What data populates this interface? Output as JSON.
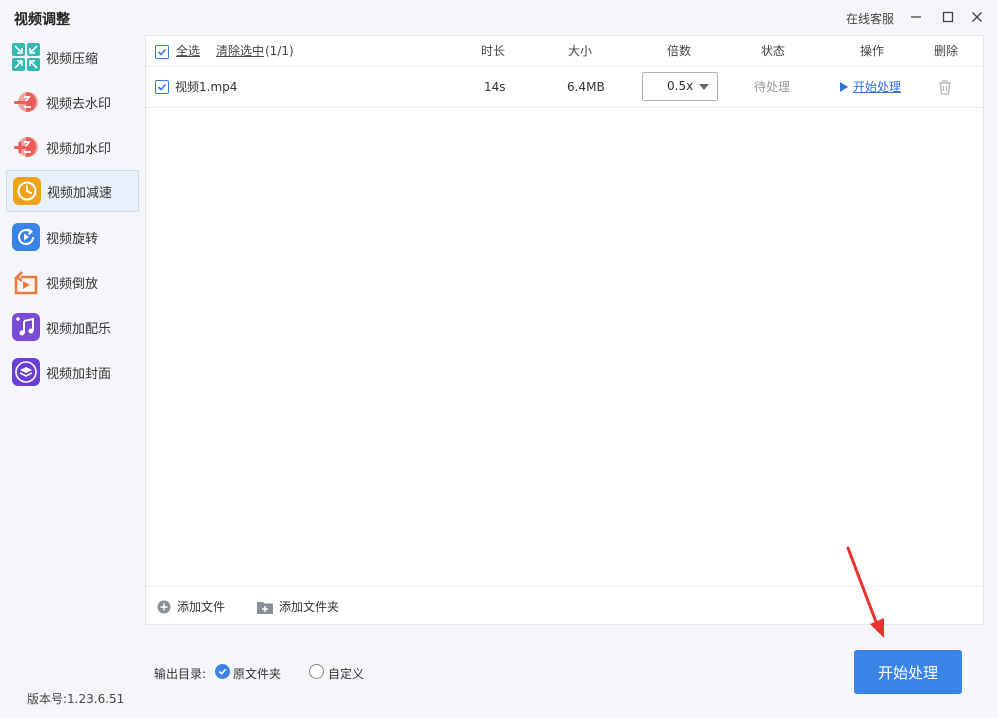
{
  "app": {
    "title": "视频调整",
    "service": "在线客服",
    "version": "版本号:1.23.6.51"
  },
  "sidebar": {
    "items": [
      {
        "label": "视频压缩",
        "icon": "compress-icon",
        "color": "#35b7b3"
      },
      {
        "label": "视频去水印",
        "icon": "remove-watermark-icon",
        "color": "#e85b57"
      },
      {
        "label": "视频加水印",
        "icon": "add-watermark-icon",
        "color": "#e85b57"
      },
      {
        "label": "视频加减速",
        "icon": "speed-icon",
        "color": "#f0a21b",
        "active": true
      },
      {
        "label": "视频旋转",
        "icon": "rotate-icon",
        "color": "#3a84e8"
      },
      {
        "label": "视频倒放",
        "icon": "reverse-play-icon",
        "color": "#ef7a3b"
      },
      {
        "label": "视频加配乐",
        "icon": "music-icon",
        "color": "#7b4bd8"
      },
      {
        "label": "视频加封面",
        "icon": "cover-icon",
        "color": "#6a3fd6"
      }
    ]
  },
  "table": {
    "select_all": "全选",
    "clear_selected": "清除选中",
    "selected_count": "(1/1)",
    "headers": {
      "duration": "时长",
      "size": "大小",
      "speed": "倍数",
      "status": "状态",
      "action": "操作",
      "delete": "删除"
    },
    "rows": [
      {
        "name": "视频1.mp4",
        "duration": "14s",
        "size": "6.4MB",
        "speed": "0.5x",
        "status": "待处理",
        "action": "开始处理"
      }
    ]
  },
  "footer": {
    "add_file": "添加文件",
    "add_folder": "添加文件夹"
  },
  "output": {
    "label": "输出目录:",
    "option_original": "原文件夹",
    "option_custom": "自定义",
    "selected": "original"
  },
  "start_button": "开始处理",
  "colors": {
    "accent": "#3a84e8",
    "arrow": "#e8322b"
  }
}
